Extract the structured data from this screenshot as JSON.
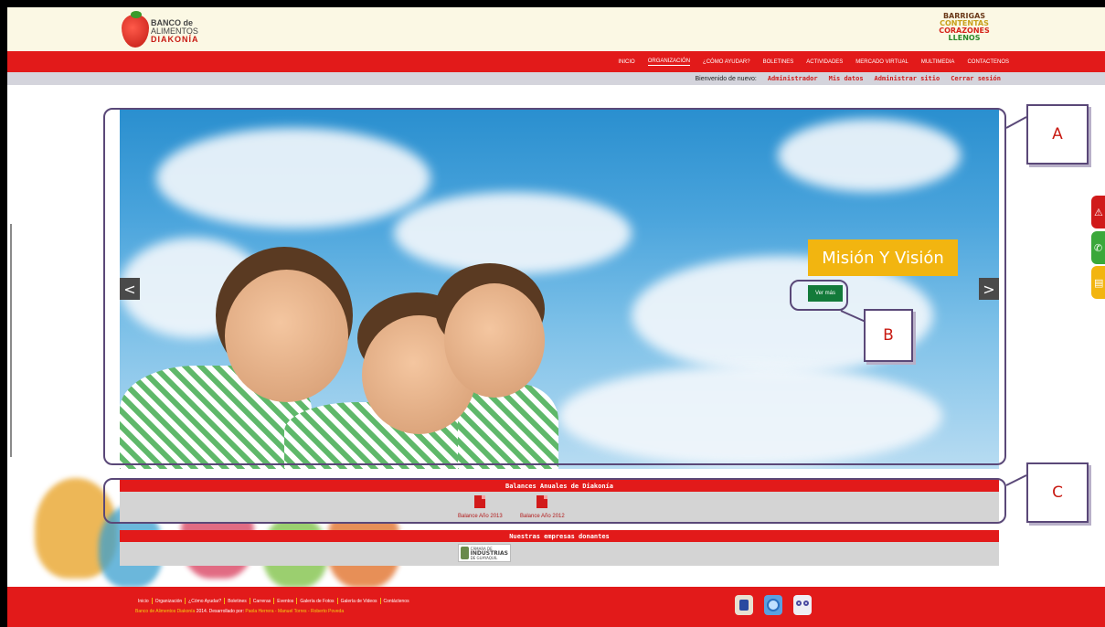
{
  "header": {
    "logo_left": {
      "line1": "BANCO de",
      "line2": "ALIMENTOS",
      "line3": "DIAKONÍA"
    },
    "logo_right": {
      "line1": "BARRIGAS",
      "line2": "CONTENTAS",
      "line3": "CORAZONES",
      "line4": "LLENOS"
    }
  },
  "nav": {
    "items": [
      {
        "label": "INICIO",
        "active": false
      },
      {
        "label": "ORGANIZACIÓN",
        "active": true
      },
      {
        "label": "¿CÓMO AYUDAR?",
        "active": false
      },
      {
        "label": "BOLETINES",
        "active": false
      },
      {
        "label": "ACTIVIDADES",
        "active": false
      },
      {
        "label": "MERCADO VIRTUAL",
        "active": false
      },
      {
        "label": "MULTIMEDIA",
        "active": false
      },
      {
        "label": "CONTACTENOS",
        "active": false
      }
    ]
  },
  "welcome": {
    "greeting": "Bienvenido de nuevo:",
    "user": "Administrador",
    "my_data": "Mis datos",
    "admin_site": "Administrar sitio",
    "logout": "Cerrar sesión"
  },
  "slider": {
    "title": "Misión Y Visión",
    "button": "Ver más",
    "prev": "<",
    "next": ">"
  },
  "balances": {
    "header": "Balances Anuales de Diakonía",
    "docs": [
      {
        "label": "Balance Año 2013",
        "icon": "pdf-icon"
      },
      {
        "label": "Balance Año 2012",
        "icon": "pdf-icon"
      }
    ]
  },
  "donors": {
    "header": "Nuestras empresas donantes",
    "logo_text": {
      "line1": "CÁMARA DE",
      "line2": "INDUSTRIAS",
      "line3": "DE GUAYAQUIL"
    }
  },
  "footer": {
    "links": [
      "Inicio",
      "Organización",
      "¿Cómo Ayudar?",
      "Boletines",
      "Carreras",
      "Eventos",
      "Galería de Fotos",
      "Galería de Videos",
      "Contáctenos"
    ],
    "credit_org": "Banco de Alimentos Diakonía",
    "credit_mid": " 2014. Desarrollado por: ",
    "credit_authors": "Paola Herrera - Manuel Torres - Roberto Poveda"
  },
  "annotations": {
    "a": "A",
    "b": "B",
    "c": "C"
  },
  "colors": {
    "brand_red": "#e21a1a",
    "accent_yellow": "#f2b510",
    "button_green": "#137a3a",
    "annotation_purple": "#5a4878"
  }
}
